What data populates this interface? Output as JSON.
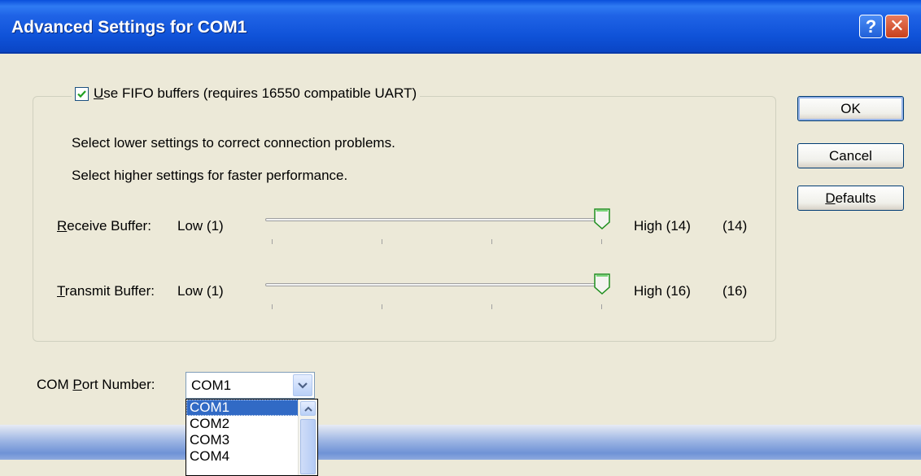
{
  "window": {
    "title": "Advanced Settings for COM1",
    "help_label": "?",
    "close_label": "✕"
  },
  "fifo": {
    "checked": true,
    "label_mnemonic": "U",
    "label_rest": "se FIFO buffers (requires 16550 compatible UART)"
  },
  "descriptions": {
    "lower": "Select lower settings to correct connection problems.",
    "higher": "Select higher settings for faster performance."
  },
  "receive": {
    "label_mnemonic": "R",
    "label_rest": "eceive Buffer:",
    "low_label": "Low (1)",
    "high_label": "High (14)",
    "value_label": "(14)",
    "value": 14,
    "min": 1,
    "max": 14
  },
  "transmit": {
    "label_mnemonic": "T",
    "label_rest": "ransmit Buffer:",
    "low_label": "Low (1)",
    "high_label": "High (16)",
    "value_label": "(16)",
    "value": 16,
    "min": 1,
    "max": 16
  },
  "buttons": {
    "ok": "OK",
    "cancel": "Cancel",
    "defaults_mnemonic": "D",
    "defaults_rest": "efaults"
  },
  "com_port": {
    "label_prefix": "COM ",
    "label_mnemonic": "P",
    "label_rest": "ort Number:",
    "selected": "COM1",
    "options": [
      "COM1",
      "COM2",
      "COM3",
      "COM4"
    ]
  }
}
